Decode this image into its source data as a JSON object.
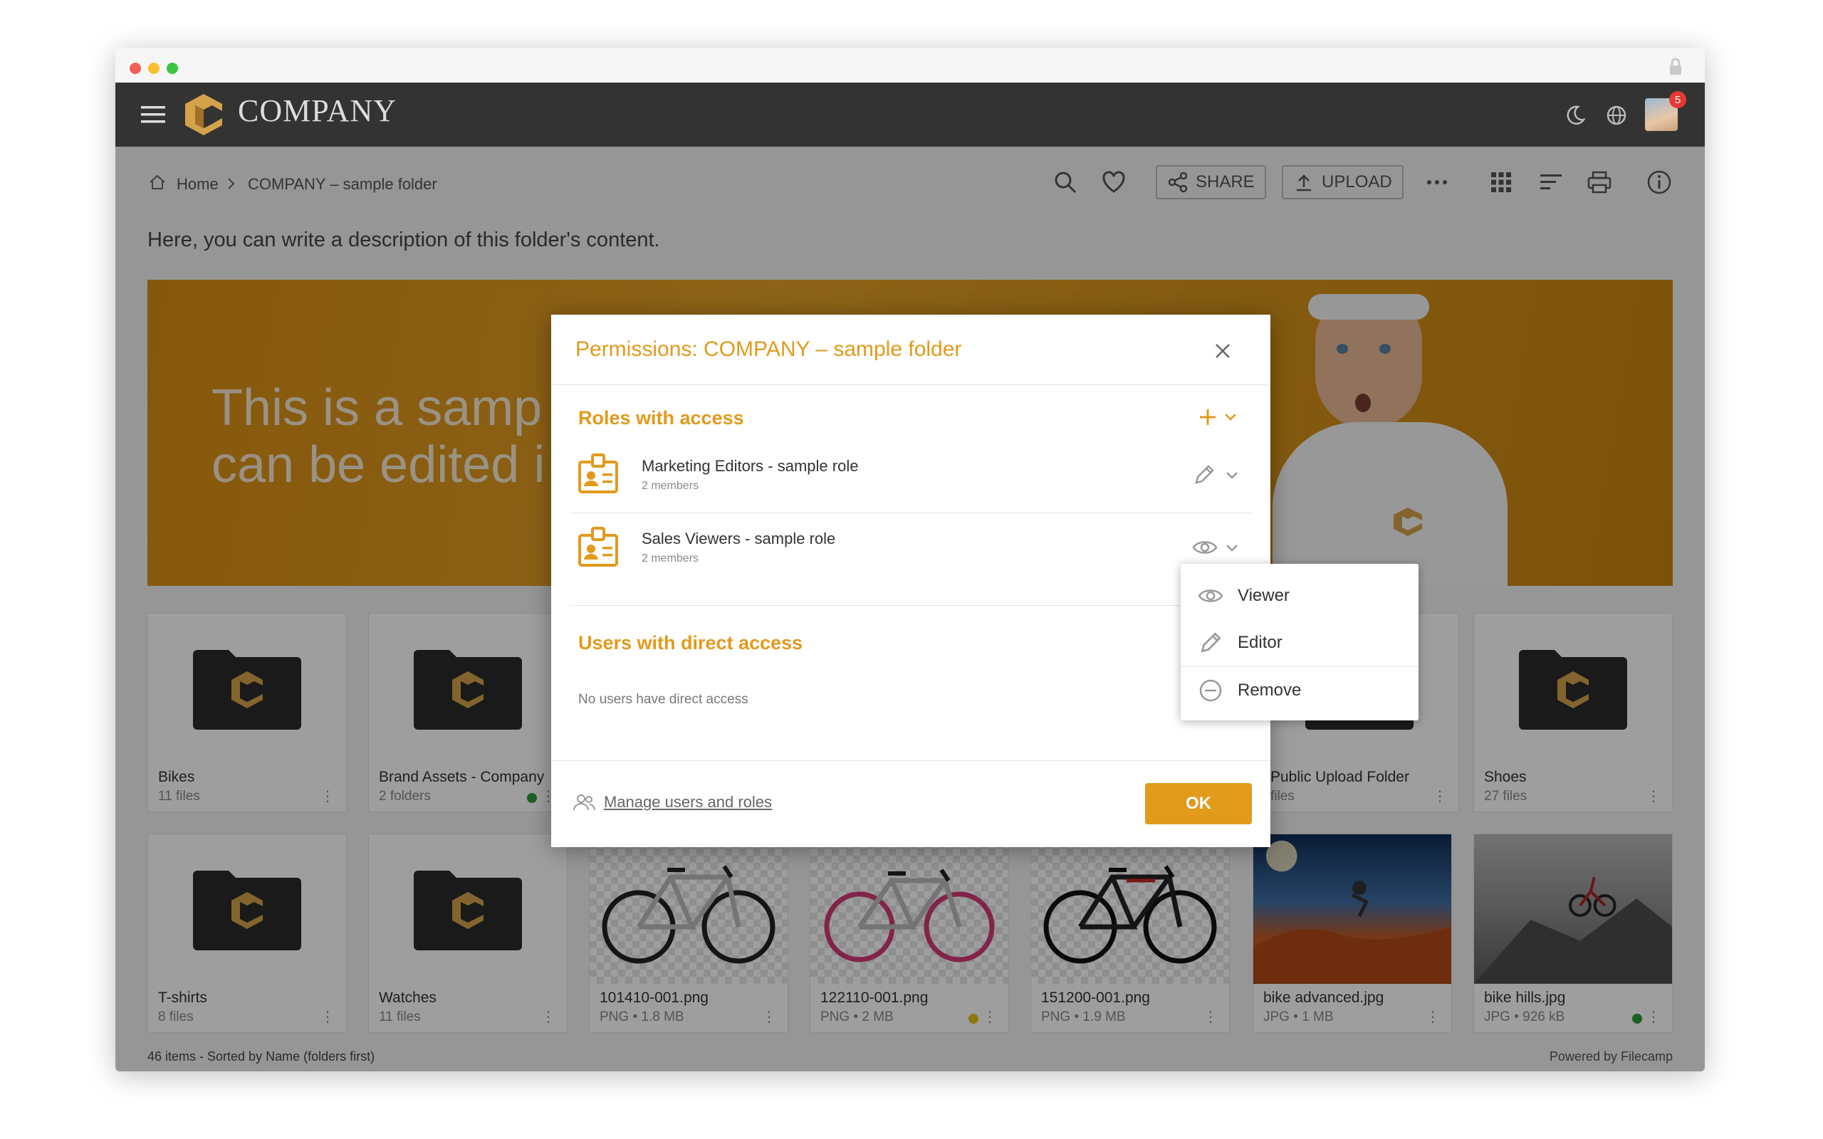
{
  "app": {
    "title": "COMPANY",
    "notifications": "5"
  },
  "breadcrumb": {
    "home": "Home",
    "current": "COMPANY – sample folder"
  },
  "toolbar": {
    "share": "SHARE",
    "upload": "UPLOAD"
  },
  "folder": {
    "description": "Here, you can write a description of this folder's content."
  },
  "banner": {
    "text": "This is a samp\ncan be edited i"
  },
  "grid": {
    "row1": [
      {
        "name": "Bikes",
        "meta": "11 files"
      },
      {
        "name": "Brand Assets - Company",
        "meta": "2 folders"
      },
      {
        "name": "Public Upload Folder",
        "meta": "files"
      },
      {
        "name": "Shoes",
        "meta": "27 files"
      }
    ],
    "row2": [
      {
        "name": "T-shirts",
        "meta": "8 files"
      },
      {
        "name": "Watches",
        "meta": "11 files"
      },
      {
        "name": "101410-001.png",
        "meta": "PNG • 1.8 MB"
      },
      {
        "name": "122110-001.png",
        "meta": "PNG • 2 MB"
      },
      {
        "name": "151200-001.png",
        "meta": "PNG • 1.9 MB"
      },
      {
        "name": "bike advanced.jpg",
        "meta": "JPG • 1 MB"
      },
      {
        "name": "bike hills.jpg",
        "meta": "JPG • 926 kB"
      }
    ]
  },
  "footer": {
    "summary": "46 items - Sorted by Name (folders first)",
    "powered": "Powered by Filecamp"
  },
  "modal": {
    "title": "Permissions: COMPANY – sample folder",
    "roles_heading": "Roles with access",
    "roles": [
      {
        "name": "Marketing Editors - sample role",
        "members": "2 members",
        "permission_icon": "pencil-icon"
      },
      {
        "name": "Sales Viewers - sample role",
        "members": "2 members",
        "permission_icon": "eye-icon"
      }
    ],
    "users_heading": "Users with direct access",
    "users_empty": "No users have direct access",
    "manage_link": "Manage users and roles",
    "ok_label": "OK"
  },
  "dropdown": {
    "items": [
      "Viewer",
      "Editor",
      "Remove"
    ]
  },
  "colors": {
    "accent": "#e29a1b",
    "topbar": "#333333"
  }
}
